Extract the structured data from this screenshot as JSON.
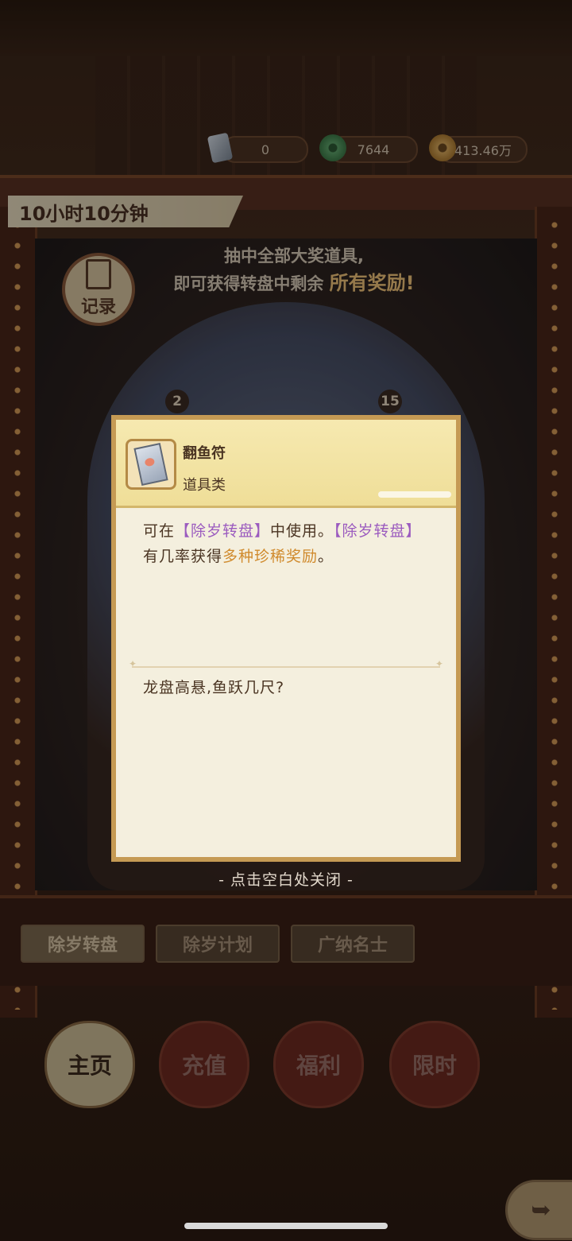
{
  "currencies": [
    {
      "icon": "ticket-icon",
      "value": "0"
    },
    {
      "icon": "jade-coin-icon",
      "value": "7644"
    },
    {
      "icon": "copper-coin-icon",
      "value": "413.46万"
    }
  ],
  "timer": "10小时10分钟",
  "banner": {
    "line1": "抽中全部大奖道具,",
    "line2_prefix": "即可获得转盘中剩余",
    "line2_highlight": "所有奖励!"
  },
  "record_label": "记录",
  "wheel_numbers": [
    "2",
    "15"
  ],
  "dialog": {
    "item_name": "翻鱼符",
    "item_category": "道具类",
    "desc": {
      "t1": "可在",
      "p1": "【除岁转盘】",
      "t2": "中使用。",
      "p2": "【除岁转盘】",
      "t3": "有几率获得",
      "o1": "多种珍稀奖励",
      "t4": "。"
    },
    "flavor": "龙盘高悬,鱼跃几尺?"
  },
  "close_hint": "点击空白处关闭",
  "tabs": [
    "除岁转盘",
    "除岁计划",
    "广纳名士"
  ],
  "nav": [
    "主页",
    "充值",
    "福利",
    "限时"
  ]
}
